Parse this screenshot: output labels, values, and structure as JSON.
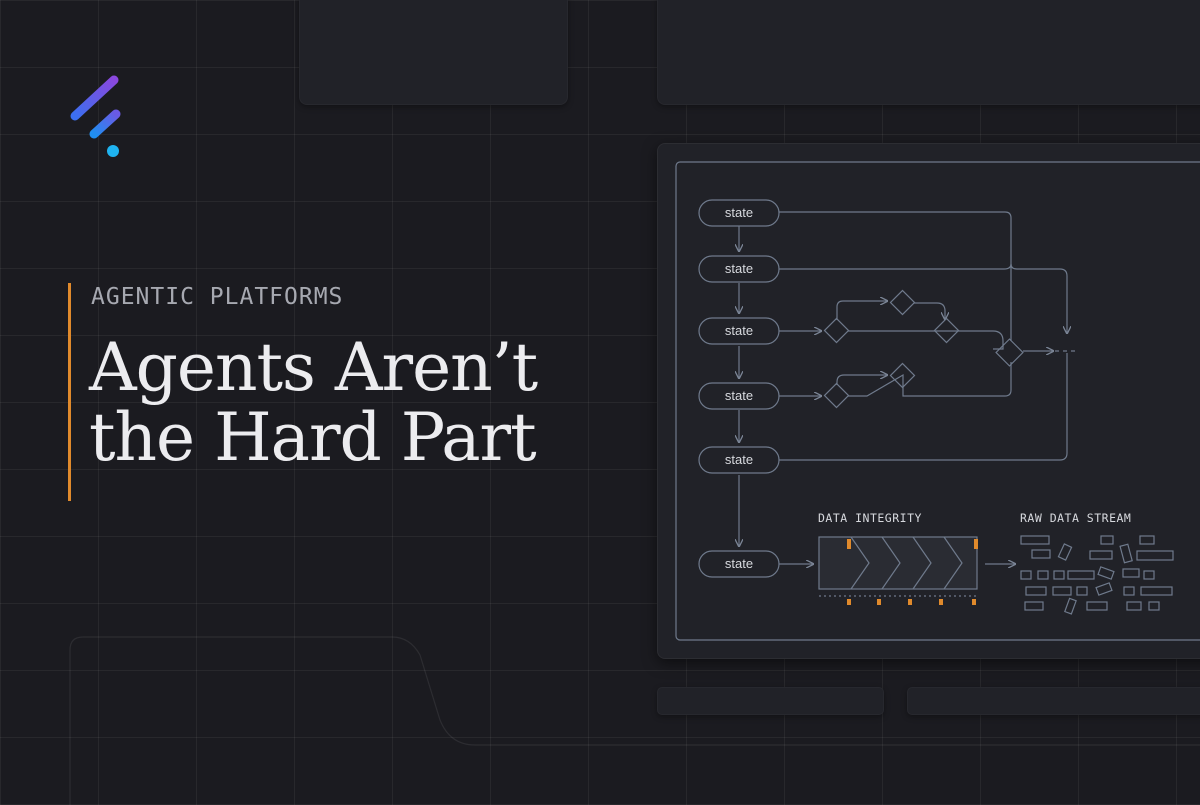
{
  "header": {
    "eyebrow": "AGENTIC PLATFORMS",
    "title_line1": "Agents Aren’t",
    "title_line2": "the Hard Part"
  },
  "colors": {
    "background": "#1b1b20",
    "accent": "#e08a2c",
    "logo_gradient": [
      "#7a4de0",
      "#2f7ee8",
      "#1fb3f0"
    ],
    "diagram_line": "#6f7a8c"
  },
  "diagram": {
    "states": [
      "state",
      "state",
      "state",
      "state",
      "state",
      "state"
    ],
    "data_integrity_label": "DATA INTEGRITY",
    "raw_data_label": "RAW DATA STREAM"
  }
}
